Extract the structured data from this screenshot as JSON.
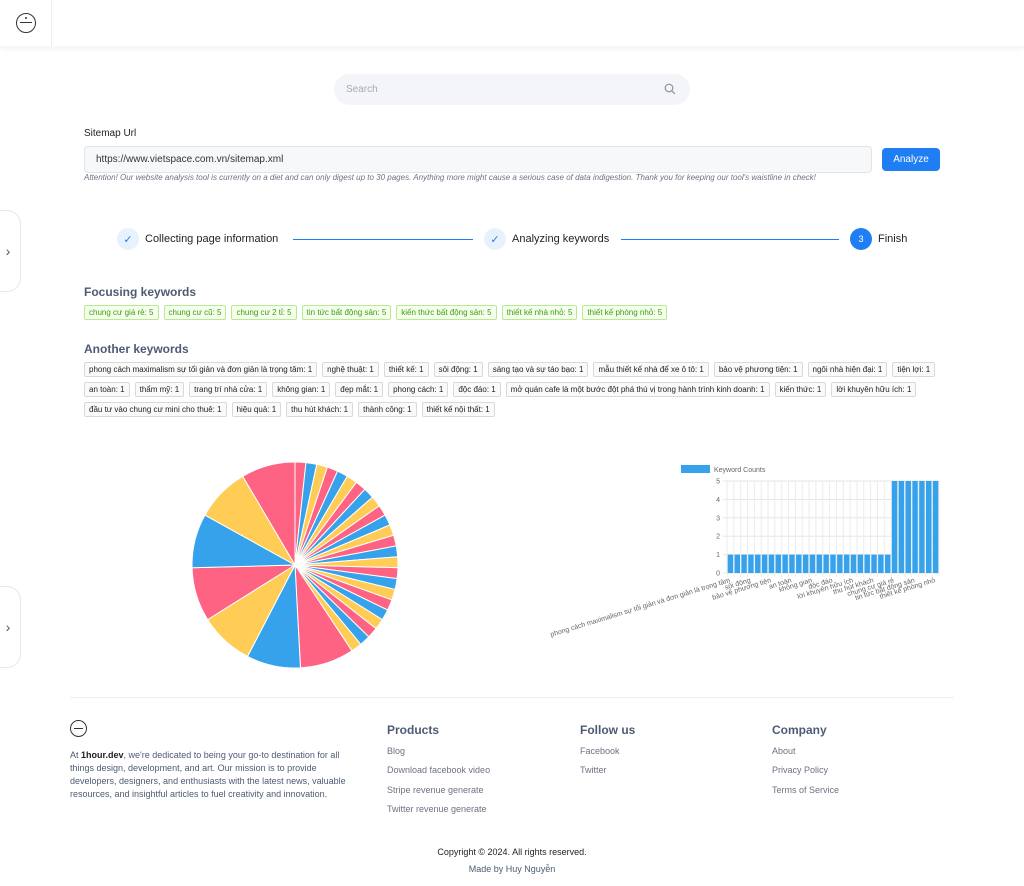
{
  "search": {
    "placeholder": "Search"
  },
  "form": {
    "sitemap_label": "Sitemap Url",
    "url_value": "https://www.vietspace.com.vn/sitemap.xml",
    "analyze_label": "Analyze",
    "attention": "Attention! Our website analysis tool is currently on a diet and can only digest up to 30 pages. Anything more might cause a serious case of data indigestion. Thank you for keeping our tool's waistline in check!"
  },
  "steps": [
    {
      "label": "Collecting page information",
      "icon": "check-icon"
    },
    {
      "label": "Analyzing keywords",
      "icon": "check-icon"
    },
    {
      "label": "Finish",
      "number": "3"
    }
  ],
  "focusing": {
    "title": "Focusing keywords",
    "tags": [
      "chung cư giá rẻ: 5",
      "chung cư cũ: 5",
      "chung cư 2 tỉ: 5",
      "tin tức bất động sản: 5",
      "kiến thức bất động sản: 5",
      "thiết kế nhà nhỏ: 5",
      "thiết kế phòng nhỏ: 5"
    ]
  },
  "another": {
    "title": "Another keywords",
    "tags": [
      "phong cách maximalism sự tối giản và đơn giản là trọng tâm: 1",
      "nghệ thuật: 1",
      "thiết kế: 1",
      "sôi động: 1",
      "sáng tạo và sự táo bạo: 1",
      "mẫu thiết kế nhà để xe ô tô: 1",
      "bảo vệ phương tiện: 1",
      "ngôi nhà hiện đại: 1",
      "tiện lợi: 1",
      "an toàn: 1",
      "thẩm mỹ: 1",
      "trang trí nhà cửa: 1",
      "không gian: 1",
      "đẹp mắt: 1",
      "phong cách: 1",
      "độc đáo: 1",
      "mở quán cafe là một bước đột phá thú vị trong hành trình kinh doanh: 1",
      "kiến thức: 1",
      "lời khuyên hữu ích: 1",
      "đầu tư vào chung cư mini cho thuê: 1",
      "hiệu quả: 1",
      "thu hút khách: 1",
      "thành công: 1",
      "thiết kế nội thất: 1"
    ]
  },
  "chart_data": [
    {
      "type": "pie",
      "colors": [
        "#ff6384",
        "#36a2eb",
        "#ffcd56"
      ],
      "categories": [
        "phong cách maximalism sự tối giản và đơn giản là trọng tâm",
        "nghệ thuật",
        "thiết kế",
        "sôi động",
        "sáng tạo và sự táo bạo",
        "mẫu thiết kế nhà để xe ô tô",
        "bảo vệ phương tiện",
        "ngôi nhà hiện đại",
        "tiện lợi",
        "an toàn",
        "thẩm mỹ",
        "trang trí nhà cửa",
        "không gian",
        "đẹp mắt",
        "phong cách",
        "độc đáo",
        "mở quán cafe là một bước đột phá thú vị trong hành trình kinh doanh",
        "kiến thức",
        "lời khuyên hữu ích",
        "đầu tư vào chung cư mini cho thuê",
        "hiệu quả",
        "thu hút khách",
        "thành công",
        "thiết kế nội thất",
        "chung cư giá rẻ",
        "chung cư cũ",
        "chung cư 2 tỉ",
        "tin tức bất động sản",
        "kiến thức bất động sản",
        "thiết kế nhà nhỏ",
        "thiết kế phòng nhỏ"
      ],
      "values": [
        1,
        1,
        1,
        1,
        1,
        1,
        1,
        1,
        1,
        1,
        1,
        1,
        1,
        1,
        1,
        1,
        1,
        1,
        1,
        1,
        1,
        1,
        1,
        1,
        5,
        5,
        5,
        5,
        5,
        5,
        5
      ]
    },
    {
      "type": "bar",
      "legend": "Keyword Counts",
      "color": "#36a2eb",
      "ylim": [
        0,
        5
      ],
      "yticks": [
        "0",
        "1",
        "2",
        "3",
        "4",
        "5"
      ],
      "categories": [
        "phong cách maximalism sự tối giản và đơn giản là trọng tâm",
        "nghệ thuật",
        "thiết kế",
        "sôi động",
        "sáng tạo và sự táo bạo",
        "mẫu thiết kế nhà để xe ô tô",
        "bảo vệ phương tiện",
        "ngôi nhà hiện đại",
        "tiện lợi",
        "an toàn",
        "thẩm mỹ",
        "trang trí nhà cửa",
        "không gian",
        "đẹp mắt",
        "phong cách",
        "độc đáo",
        "mở quán cafe là một bước đột phá thú vị trong hành trình kinh doanh",
        "kiến thức",
        "lời khuyên hữu ích",
        "đầu tư vào chung cư mini cho thuê",
        "hiệu quả",
        "thu hút khách",
        "thành công",
        "thiết kế nội thất",
        "chung cư giá rẻ",
        "chung cư cũ",
        "chung cư 2 tỉ",
        "tin tức bất động sản",
        "kiến thức bất động sản",
        "thiết kế nhà nhỏ",
        "thiết kế phòng nhỏ"
      ],
      "values": [
        1,
        1,
        1,
        1,
        1,
        1,
        1,
        1,
        1,
        1,
        1,
        1,
        1,
        1,
        1,
        1,
        1,
        1,
        1,
        1,
        1,
        1,
        1,
        1,
        5,
        5,
        5,
        5,
        5,
        5,
        5
      ],
      "visible_labels": [
        "phong cách maximalism sự tối giản và đơn giản là trọng tâm",
        "sôi động",
        "bảo vệ phương tiện",
        "an toàn",
        "không gian",
        "độc đáo",
        "lời khuyên hữu ích",
        "thu hút khách",
        "chung cư giá rẻ",
        "tin tức bất động sản",
        "thiết kế phòng nhỏ"
      ],
      "visible_label_indices": [
        0,
        3,
        6,
        9,
        12,
        15,
        18,
        21,
        24,
        27,
        30
      ]
    }
  ],
  "footer": {
    "about_brand": "1hour.dev",
    "about_prefix": "At ",
    "about_text": ", we're dedicated to being your go-to destination for all things design, development, and art. Our mission is to provide developers, designers, and enthusiasts with the latest news, valuable resources, and insightful articles to fuel creativity and innovation.",
    "products": {
      "title": "Products",
      "links": [
        "Blog",
        "Download facebook video",
        "Stripe revenue generate",
        "Twitter revenue generate"
      ]
    },
    "follow": {
      "title": "Follow us",
      "links": [
        "Facebook",
        "Twitter"
      ]
    },
    "company": {
      "title": "Company",
      "links": [
        "About",
        "Privacy Policy",
        "Terms of Service"
      ]
    },
    "copyright": "Copyright © 2024. All rights reserved.",
    "made_by": "Made by Huy Nguyễn"
  }
}
